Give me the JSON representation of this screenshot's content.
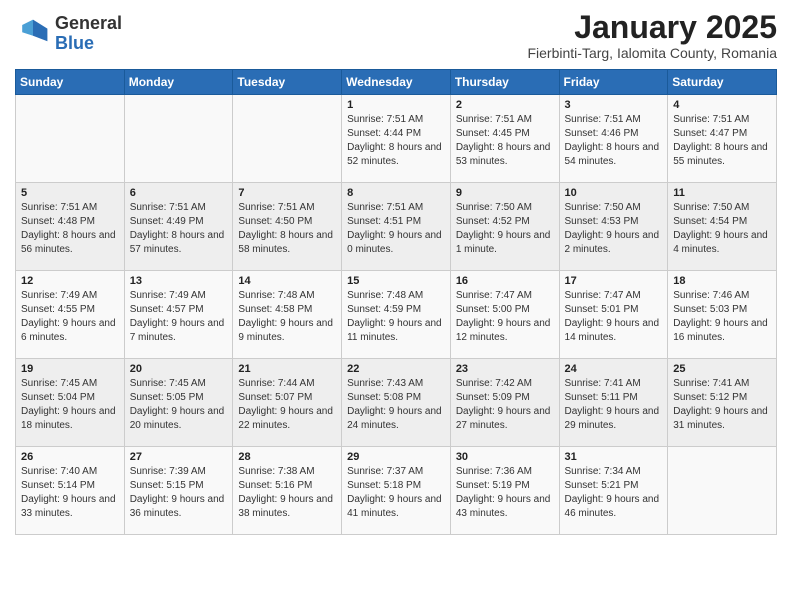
{
  "header": {
    "logo_general": "General",
    "logo_blue": "Blue",
    "title": "January 2025",
    "subtitle": "Fierbinti-Targ, Ialomita County, Romania"
  },
  "weekdays": [
    "Sunday",
    "Monday",
    "Tuesday",
    "Wednesday",
    "Thursday",
    "Friday",
    "Saturday"
  ],
  "weeks": [
    [
      {
        "day": "",
        "content": ""
      },
      {
        "day": "",
        "content": ""
      },
      {
        "day": "",
        "content": ""
      },
      {
        "day": "1",
        "content": "Sunrise: 7:51 AM\nSunset: 4:44 PM\nDaylight: 8 hours and 52 minutes."
      },
      {
        "day": "2",
        "content": "Sunrise: 7:51 AM\nSunset: 4:45 PM\nDaylight: 8 hours and 53 minutes."
      },
      {
        "day": "3",
        "content": "Sunrise: 7:51 AM\nSunset: 4:46 PM\nDaylight: 8 hours and 54 minutes."
      },
      {
        "day": "4",
        "content": "Sunrise: 7:51 AM\nSunset: 4:47 PM\nDaylight: 8 hours and 55 minutes."
      }
    ],
    [
      {
        "day": "5",
        "content": "Sunrise: 7:51 AM\nSunset: 4:48 PM\nDaylight: 8 hours and 56 minutes."
      },
      {
        "day": "6",
        "content": "Sunrise: 7:51 AM\nSunset: 4:49 PM\nDaylight: 8 hours and 57 minutes."
      },
      {
        "day": "7",
        "content": "Sunrise: 7:51 AM\nSunset: 4:50 PM\nDaylight: 8 hours and 58 minutes."
      },
      {
        "day": "8",
        "content": "Sunrise: 7:51 AM\nSunset: 4:51 PM\nDaylight: 9 hours and 0 minutes."
      },
      {
        "day": "9",
        "content": "Sunrise: 7:50 AM\nSunset: 4:52 PM\nDaylight: 9 hours and 1 minute."
      },
      {
        "day": "10",
        "content": "Sunrise: 7:50 AM\nSunset: 4:53 PM\nDaylight: 9 hours and 2 minutes."
      },
      {
        "day": "11",
        "content": "Sunrise: 7:50 AM\nSunset: 4:54 PM\nDaylight: 9 hours and 4 minutes."
      }
    ],
    [
      {
        "day": "12",
        "content": "Sunrise: 7:49 AM\nSunset: 4:55 PM\nDaylight: 9 hours and 6 minutes."
      },
      {
        "day": "13",
        "content": "Sunrise: 7:49 AM\nSunset: 4:57 PM\nDaylight: 9 hours and 7 minutes."
      },
      {
        "day": "14",
        "content": "Sunrise: 7:48 AM\nSunset: 4:58 PM\nDaylight: 9 hours and 9 minutes."
      },
      {
        "day": "15",
        "content": "Sunrise: 7:48 AM\nSunset: 4:59 PM\nDaylight: 9 hours and 11 minutes."
      },
      {
        "day": "16",
        "content": "Sunrise: 7:47 AM\nSunset: 5:00 PM\nDaylight: 9 hours and 12 minutes."
      },
      {
        "day": "17",
        "content": "Sunrise: 7:47 AM\nSunset: 5:01 PM\nDaylight: 9 hours and 14 minutes."
      },
      {
        "day": "18",
        "content": "Sunrise: 7:46 AM\nSunset: 5:03 PM\nDaylight: 9 hours and 16 minutes."
      }
    ],
    [
      {
        "day": "19",
        "content": "Sunrise: 7:45 AM\nSunset: 5:04 PM\nDaylight: 9 hours and 18 minutes."
      },
      {
        "day": "20",
        "content": "Sunrise: 7:45 AM\nSunset: 5:05 PM\nDaylight: 9 hours and 20 minutes."
      },
      {
        "day": "21",
        "content": "Sunrise: 7:44 AM\nSunset: 5:07 PM\nDaylight: 9 hours and 22 minutes."
      },
      {
        "day": "22",
        "content": "Sunrise: 7:43 AM\nSunset: 5:08 PM\nDaylight: 9 hours and 24 minutes."
      },
      {
        "day": "23",
        "content": "Sunrise: 7:42 AM\nSunset: 5:09 PM\nDaylight: 9 hours and 27 minutes."
      },
      {
        "day": "24",
        "content": "Sunrise: 7:41 AM\nSunset: 5:11 PM\nDaylight: 9 hours and 29 minutes."
      },
      {
        "day": "25",
        "content": "Sunrise: 7:41 AM\nSunset: 5:12 PM\nDaylight: 9 hours and 31 minutes."
      }
    ],
    [
      {
        "day": "26",
        "content": "Sunrise: 7:40 AM\nSunset: 5:14 PM\nDaylight: 9 hours and 33 minutes."
      },
      {
        "day": "27",
        "content": "Sunrise: 7:39 AM\nSunset: 5:15 PM\nDaylight: 9 hours and 36 minutes."
      },
      {
        "day": "28",
        "content": "Sunrise: 7:38 AM\nSunset: 5:16 PM\nDaylight: 9 hours and 38 minutes."
      },
      {
        "day": "29",
        "content": "Sunrise: 7:37 AM\nSunset: 5:18 PM\nDaylight: 9 hours and 41 minutes."
      },
      {
        "day": "30",
        "content": "Sunrise: 7:36 AM\nSunset: 5:19 PM\nDaylight: 9 hours and 43 minutes."
      },
      {
        "day": "31",
        "content": "Sunrise: 7:34 AM\nSunset: 5:21 PM\nDaylight: 9 hours and 46 minutes."
      },
      {
        "day": "",
        "content": ""
      }
    ]
  ]
}
